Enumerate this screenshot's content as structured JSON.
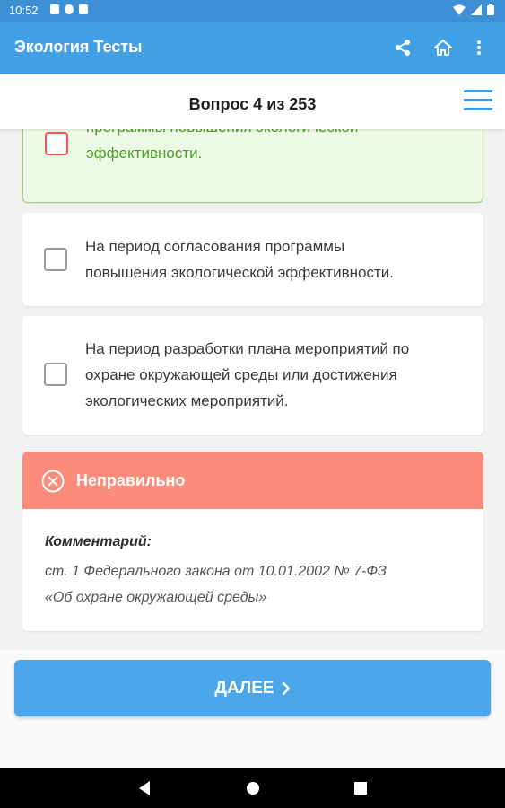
{
  "status_bar": {
    "time": "10:52"
  },
  "app_bar": {
    "title": "Экология Тесты",
    "icons": [
      "share-icon",
      "home-icon",
      "more-vert-icon"
    ]
  },
  "question": {
    "counter": "Вопрос 4 из 253"
  },
  "answers": [
    {
      "text_lines": [
        "программы повышения экологической",
        "эффективности."
      ],
      "state": "correct"
    },
    {
      "text_lines": [
        "На период согласования программы",
        "повышения экологической эффективности."
      ],
      "state": "neutral"
    },
    {
      "text_lines": [
        "На период разработки плана мероприятий по",
        "охране окружающей среды или достижения",
        "экологических мероприятий."
      ],
      "state": "neutral"
    }
  ],
  "result": {
    "title": "Неправильно",
    "comment_label": "Комментарий:",
    "comment_lines": [
      "ст. 1 Федерального закона от 10.01.2002 № 7-ФЗ",
      "«Об охране окружающей среды»"
    ]
  },
  "next_button": {
    "label": "ДАЛЕЕ"
  },
  "colors": {
    "app_bar": "#42a0e6",
    "correct_text": "#49a025",
    "wrong_header": "#fb8b7a",
    "button": "#4aa6e8"
  }
}
